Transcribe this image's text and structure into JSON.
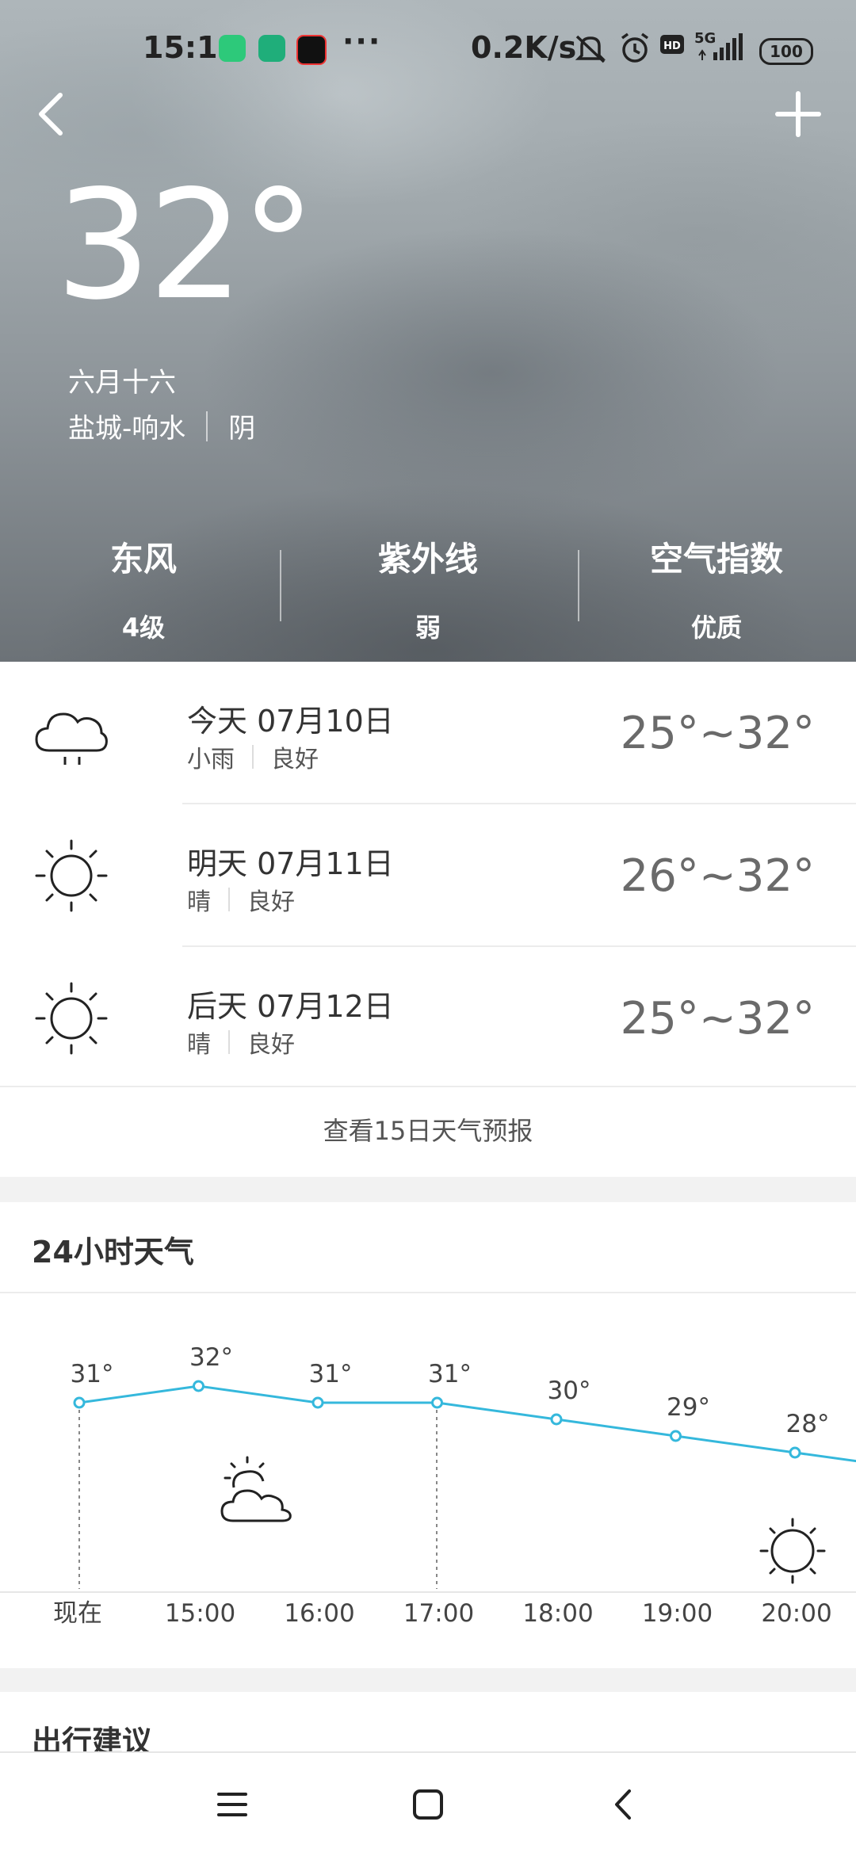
{
  "status_bar": {
    "time": "15:11",
    "dots": "···",
    "net_speed": "0.2K/s",
    "signal": "5G",
    "battery": "100",
    "icons": [
      "app-icon-green",
      "app-icon-fingerprint",
      "app-icon-tiktok",
      "mute-icon",
      "alarm-icon",
      "hd-icon",
      "signal-icon"
    ]
  },
  "header": {
    "back_icon": "chevron-left-icon",
    "add_icon": "plus-icon"
  },
  "current": {
    "temperature": "32°",
    "lunar_date": "六月十六",
    "location": "盐城-响水",
    "condition": "阴"
  },
  "metrics": [
    {
      "label": "东风",
      "value": "4级"
    },
    {
      "label": "紫外线",
      "value": "弱"
    },
    {
      "label": "空气指数",
      "value": "优质"
    }
  ],
  "forecast": {
    "days": [
      {
        "date": "今天 07月10日",
        "weather": "小雨",
        "air": "良好",
        "range": "25°~32°",
        "icon": "rain-cloud-icon"
      },
      {
        "date": "明天 07月11日",
        "weather": "晴",
        "air": "良好",
        "range": "26°~32°",
        "icon": "sun-icon"
      },
      {
        "date": "后天 07月12日",
        "weather": "晴",
        "air": "良好",
        "range": "25°~32°",
        "icon": "sun-icon"
      }
    ],
    "more_link": "查看15日天气预报"
  },
  "hourly": {
    "title": "24小时天气",
    "line_color": "#35b8dc",
    "icons": [
      "partly-cloudy-icon",
      "sun-icon"
    ]
  },
  "chart_data": {
    "type": "line",
    "categories": [
      "现在",
      "15:00",
      "16:00",
      "17:00",
      "18:00",
      "19:00",
      "20:00"
    ],
    "series": [
      {
        "values": [
          31,
          32,
          31,
          31,
          30,
          29,
          28
        ]
      }
    ],
    "point_labels": [
      "31°",
      "32°",
      "31°",
      "31°",
      "30°",
      "29°",
      "28°"
    ],
    "title": "24小时天气",
    "xlabel": "",
    "ylabel": "",
    "grid": false
  },
  "travel": {
    "title": "出行建议"
  },
  "navbar": {
    "icons": [
      "menu-icon",
      "home-square-icon",
      "back-triangle-icon"
    ]
  }
}
